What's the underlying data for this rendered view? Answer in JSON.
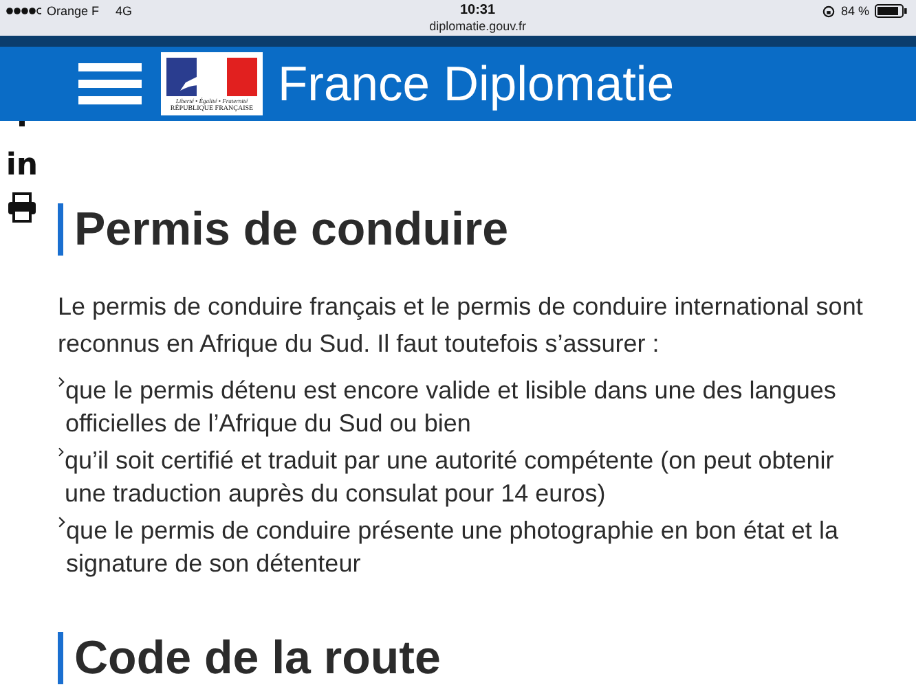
{
  "status_bar": {
    "carrier": "Orange F",
    "network": "4G",
    "time": "10:31",
    "url": "diplomatie.gouv.fr",
    "battery": "84 %"
  },
  "header": {
    "logo": {
      "motto": "Liberté • Égalité • Fraternité",
      "name": "RÉPUBLIQUE FRANÇAISE"
    },
    "title": "France Diplomatie"
  },
  "share": [
    {
      "kind": "linkedin",
      "label": "in"
    },
    {
      "kind": "print"
    }
  ],
  "article": {
    "heading": "Permis de conduire",
    "intro": "Le permis de conduire français et le permis de conduire international sont reconnus en Afrique du Sud. Il faut toutefois s’assurer :",
    "items": [
      "que le permis détenu est encore valide et lisible dans une des langues officielles de l’Afrique du Sud ou bien",
      "qu’il soit certifié et traduit par une autorité compétente (on peut obtenir une traduction auprès du consulat pour 14 euros)",
      "que le permis de conduire présente une photographie en bon état et la signature de son détenteur"
    ],
    "next_heading": "Code de la route"
  }
}
